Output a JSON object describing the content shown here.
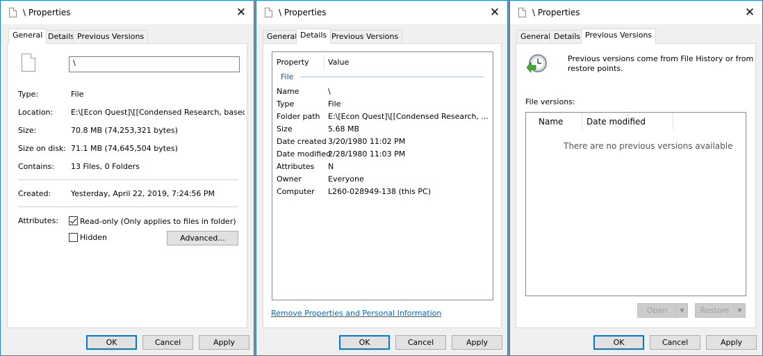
{
  "window_title": "\\ Properties",
  "close_glyph": "✕",
  "general": {
    "tabs": [
      "General",
      "Details",
      "Previous Versions"
    ],
    "name_value": "\\",
    "rows": [
      {
        "label": "Type:",
        "value": "File"
      },
      {
        "label": "Location:",
        "value": "E:\\[Econ Quest]\\[[Condensed Research, based on"
      },
      {
        "label": "Size:",
        "value": "70.8 MB (74,253,321 bytes)"
      },
      {
        "label": "Size on disk:",
        "value": "71.1 MB (74,645,504 bytes)"
      },
      {
        "label": "Contains:",
        "value": "13 Files, 0 Folders"
      }
    ],
    "created_label": "Created:",
    "created_value": "Yesterday, April 22, 2019, 7:24:56 PM",
    "attributes_label": "Attributes:",
    "readonly_label": "Read-only (Only applies to files in folder)",
    "readonly_checked": true,
    "hidden_label": "Hidden",
    "hidden_checked": false,
    "advanced_label": "Advanced..."
  },
  "details": {
    "tabs": [
      "General",
      "Details",
      "Previous Versions"
    ],
    "col_property": "Property",
    "col_value": "Value",
    "group": "File",
    "rows": [
      {
        "label": "Name",
        "value": "\\"
      },
      {
        "label": "Type",
        "value": "File"
      },
      {
        "label": "Folder path",
        "value": "E:\\[Econ Quest]\\[[Condensed Research, ..."
      },
      {
        "label": "Size",
        "value": "5.68 MB"
      },
      {
        "label": "Date created",
        "value": "3/20/1980 11:02 PM"
      },
      {
        "label": "Date modified",
        "value": "2/28/1980 11:03 PM"
      },
      {
        "label": "Attributes",
        "value": "N"
      },
      {
        "label": "Owner",
        "value": "Everyone"
      },
      {
        "label": "Computer",
        "value": "L260-028949-138 (this PC)"
      }
    ],
    "remove_link": "Remove Properties and Personal Information"
  },
  "prev_versions": {
    "tabs": [
      "General",
      "Details",
      "Previous Versions"
    ],
    "info_line1": "Previous versions come from File History or from",
    "info_line2": "restore points.",
    "file_versions_label": "File versions:",
    "col_name": "Name",
    "col_date": "Date modified",
    "empty_text": "There are no previous versions available",
    "open_label": "Open",
    "restore_label": "Restore"
  },
  "buttons": {
    "ok": "OK",
    "cancel": "Cancel",
    "apply": "Apply"
  },
  "colors": {
    "accent": "#0078d7",
    "link": "#0066cc",
    "group": "#1f4e9c"
  }
}
